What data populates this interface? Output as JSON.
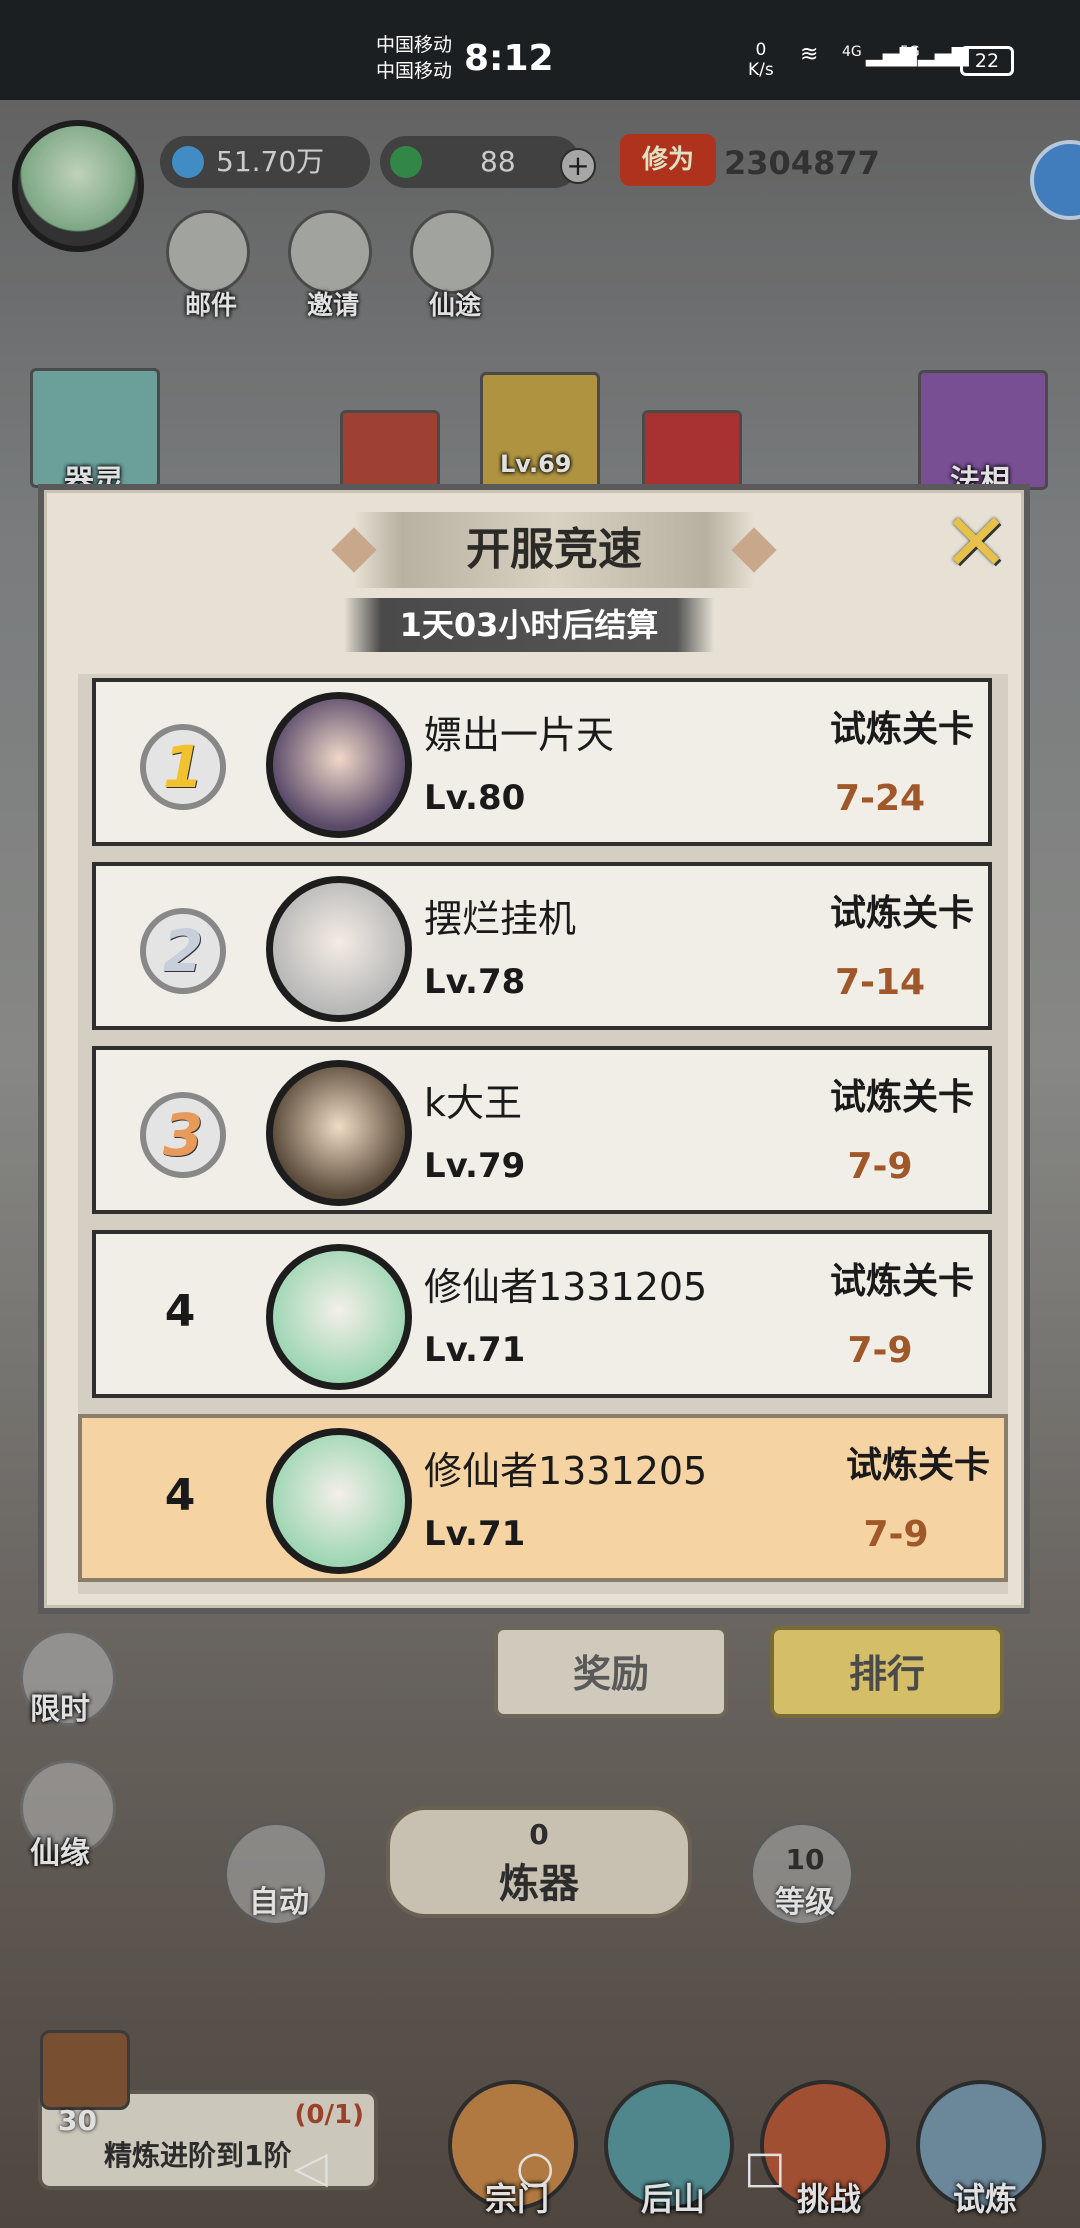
{
  "status_bar": {
    "carrier1": "中国移动",
    "carrier2": "中国移动",
    "time": "8:12",
    "net_speed_value": "0",
    "net_speed_unit": "K/s",
    "signal1": "4G",
    "signal2": "5G",
    "battery": "22"
  },
  "header": {
    "spirit_stones": "51.70万",
    "jade": "88",
    "plus": "+",
    "cultivation_label": "修为",
    "cultivation_value": "2304877"
  },
  "top_buttons": [
    "邮件",
    "邀请",
    "仙途"
  ],
  "side_labels": {
    "left_top": "器灵",
    "right_top": "法相",
    "card_level": "Lv.69",
    "limited": "限时",
    "fate": "仙缘"
  },
  "modal": {
    "title": "开服竞速",
    "close": "✕",
    "timer": "1天03小时后结算",
    "rows": [
      {
        "rank": "1",
        "name": "嫖出一片天",
        "level": "Lv.80",
        "stage_label": "试炼关卡",
        "stage": "7-24"
      },
      {
        "rank": "2",
        "name": "摆烂挂机",
        "level": "Lv.78",
        "stage_label": "试炼关卡",
        "stage": "7-14"
      },
      {
        "rank": "3",
        "name": "k大王",
        "level": "Lv.79",
        "stage_label": "试炼关卡",
        "stage": "7-9"
      },
      {
        "rank": "4",
        "name": "修仙者1331205",
        "level": "Lv.71",
        "stage_label": "试炼关卡",
        "stage": "7-9"
      }
    ],
    "self_row": {
      "rank": "4",
      "name": "修仙者1331205",
      "level": "Lv.71",
      "stage_label": "试炼关卡",
      "stage": "7-9"
    }
  },
  "under_modal": {
    "reward": "奖励",
    "ranking": "排行"
  },
  "center": {
    "auto": "自动",
    "forge_count": "0",
    "forge": "炼器",
    "level_num": "10",
    "level": "等级"
  },
  "quest": {
    "text": "精炼进阶到1阶",
    "progress": "(0/1)",
    "chest_count": "30"
  },
  "bottom_nav": [
    "宗门",
    "后山",
    "挑战",
    "试炼"
  ],
  "system_nav": {
    "back": "◁",
    "home": "○",
    "recent": "□"
  }
}
